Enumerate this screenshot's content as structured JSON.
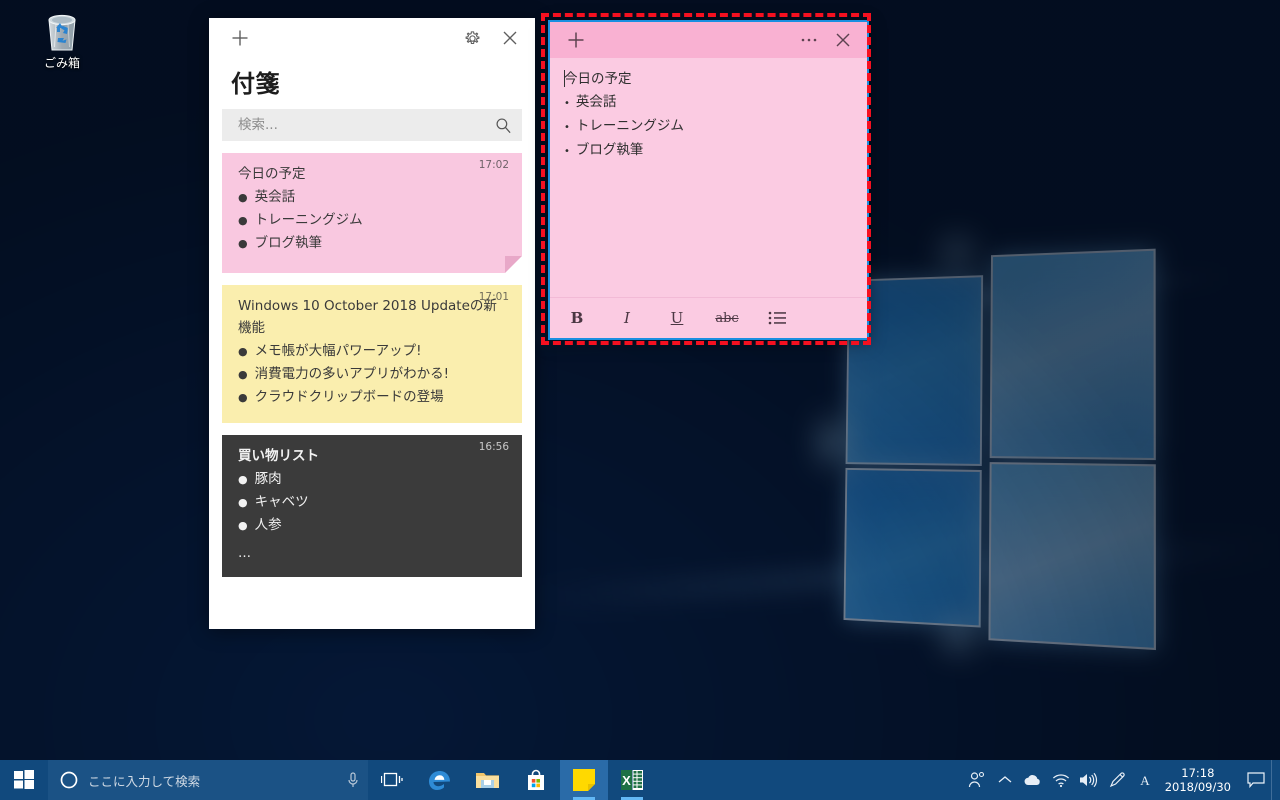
{
  "desktop": {
    "recycle_bin": {
      "label": "ごみ箱",
      "icon": "recycle-bin-icon"
    }
  },
  "notes_list_window": {
    "title": "付箋",
    "add_label": "+",
    "settings_icon": "gear-icon",
    "close_icon": "close-icon",
    "search": {
      "placeholder": "検索...",
      "value": "",
      "icon": "search-icon"
    },
    "notes": [
      {
        "color": "pink",
        "time": "17:02",
        "title": "今日の予定",
        "items": [
          "英会話",
          "トレーニングジム",
          "ブログ執筆"
        ],
        "bullet": "●",
        "truncated": ""
      },
      {
        "color": "yellow",
        "time": "17:01",
        "title": "Windows 10 October 2018 Updateの新機能",
        "items": [
          "メモ帳が大幅パワーアップ!",
          "消費電力の多いアプリがわかる!",
          "クラウドクリップボードの登場"
        ],
        "bullet": "●",
        "truncated": ""
      },
      {
        "color": "dark",
        "time": "16:56",
        "title": "買い物リスト",
        "items": [
          "豚肉",
          "キャベツ",
          "人参"
        ],
        "bullet": "●",
        "truncated": "…"
      }
    ]
  },
  "sticky_note_window": {
    "color_hex": "#fbcbe2",
    "titlebar_hex": "#f9b1d2",
    "add_label": "+",
    "menu_label": "…",
    "close_icon": "close-icon",
    "content": {
      "title": "今日の予定",
      "bullet": "•",
      "items": [
        "英会話",
        "トレーニングジム",
        "ブログ執筆"
      ]
    },
    "toolbar": [
      {
        "name": "bold",
        "label": "B"
      },
      {
        "name": "italic",
        "label": "I"
      },
      {
        "name": "underline",
        "label": "U"
      },
      {
        "name": "strikethrough",
        "label": "abc"
      },
      {
        "name": "bullet-list",
        "label": ""
      }
    ]
  },
  "annotation": {
    "color_hex": "#f51020",
    "style": "dashed-rectangle"
  },
  "taskbar": {
    "start_icon": "windows-start-icon",
    "search": {
      "placeholder": "ここに入力して検索",
      "value": "",
      "cortana_icon": "cortana-circle-icon",
      "mic_icon": "microphone-icon"
    },
    "apps": [
      {
        "name": "task-view",
        "icon": "task-view-icon",
        "running": false
      },
      {
        "name": "microsoft-edge",
        "icon": "edge-icon",
        "running": false
      },
      {
        "name": "file-explorer",
        "icon": "folder-icon",
        "running": false
      },
      {
        "name": "microsoft-store",
        "icon": "store-bag-icon",
        "running": false
      },
      {
        "name": "sticky-notes",
        "icon": "sticky-note-icon",
        "running": true,
        "active": true
      },
      {
        "name": "excel",
        "icon": "excel-icon",
        "running": true,
        "active": false
      }
    ],
    "tray": [
      {
        "name": "people",
        "icon": "people-icon"
      },
      {
        "name": "show-hidden-icons",
        "icon": "chevron-up-icon"
      },
      {
        "name": "onedrive",
        "icon": "cloud-icon"
      },
      {
        "name": "network",
        "icon": "wifi-icon"
      },
      {
        "name": "volume",
        "icon": "speaker-icon"
      },
      {
        "name": "pen-workspace",
        "icon": "pen-icon"
      },
      {
        "name": "ime-mode",
        "icon": "ime-a-icon",
        "label": "A"
      }
    ],
    "clock": {
      "time": "17:18",
      "date": "2018/09/30"
    },
    "notifications_icon": "notification-icon"
  }
}
